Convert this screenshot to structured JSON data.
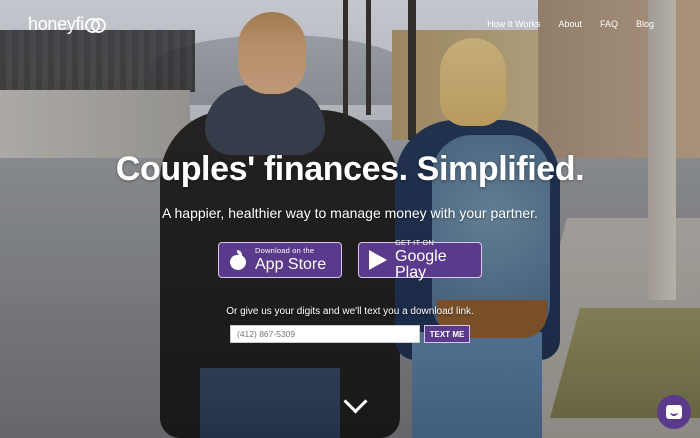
{
  "header": {
    "logo_text": "honeyfi",
    "nav": [
      {
        "label": "How It Works"
      },
      {
        "label": "About"
      },
      {
        "label": "FAQ"
      },
      {
        "label": "Blog"
      }
    ]
  },
  "hero": {
    "headline": "Couples' finances. Simplified.",
    "subhead": "A happier, healthier way to manage money with your partner.",
    "app_store": {
      "small": "Download on the",
      "big": "App Store"
    },
    "google_play": {
      "small": "GET IT ON",
      "big": "Google Play"
    },
    "sms_prompt": "Or give us your digits and we'll text you a download link.",
    "phone_placeholder": "(412) 867-5309",
    "text_me_label": "TEXT ME"
  },
  "icons": {
    "scroll": "chevron-down-icon",
    "chat": "chat-icon",
    "apple": "apple-icon",
    "google_play": "google-play-icon"
  },
  "colors": {
    "brand_purple": "#5a3a8a",
    "button_border": "#d6c8ec"
  }
}
